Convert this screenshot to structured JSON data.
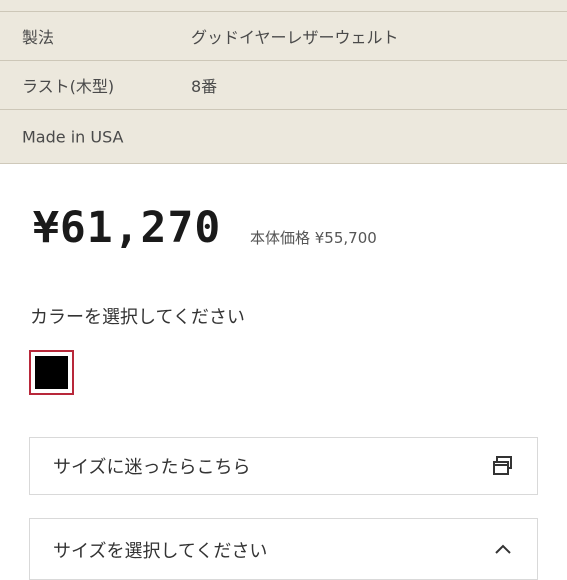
{
  "specs": [
    {
      "label": "製法",
      "value": "グッドイヤーレザーウェルト"
    },
    {
      "label": "ラスト(木型)",
      "value": "8番"
    },
    {
      "label": "Made in USA",
      "value": ""
    }
  ],
  "price": {
    "amount": "¥61,270",
    "base": "本体価格 ¥55,700"
  },
  "color": {
    "heading": "カラーを選択してください",
    "selected_swatch": "#000000",
    "selected_border": "#b8283a"
  },
  "size_guide": {
    "label": "サイズに迷ったらこちら",
    "icon": "external-window-icon"
  },
  "size_select": {
    "label": "サイズを選択してください",
    "icon": "chevron-up-icon"
  }
}
